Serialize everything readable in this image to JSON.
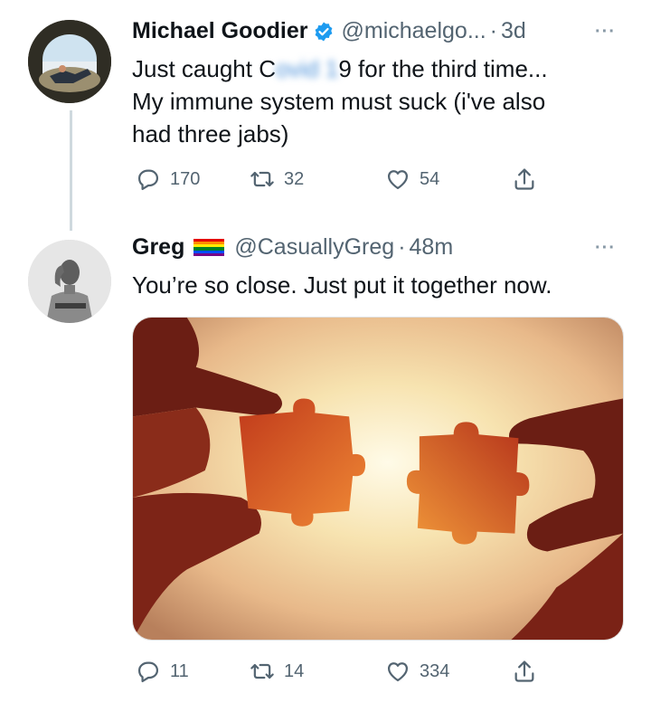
{
  "tweets": [
    {
      "display_name": "Michael Goodier",
      "verified": true,
      "handle": "@michaelgo...",
      "separator": "·",
      "time": "3d",
      "more": "···",
      "text_lines": [
        "Just caught Covid 19 for the third time...",
        "My immune system must suck (i've also",
        "had three jabs)"
      ],
      "text_before_blur": "Just caught C",
      "blurred_text": "ovid 1",
      "text_after_blur": "9 for the third time...",
      "actions": {
        "replies": "170",
        "retweets": "32",
        "likes": "54"
      }
    },
    {
      "display_name": "Greg",
      "badge": "rainbow-flag",
      "handle": "@CasuallyGreg",
      "separator": "·",
      "time": "48m",
      "more": "···",
      "text": "You’re so close. Just put it together now.",
      "media": {
        "description_icon": "puzzle-pieces-image"
      },
      "actions": {
        "replies": "11",
        "retweets": "14",
        "likes": "334"
      }
    }
  ],
  "colors": {
    "text_primary": "#0f1419",
    "text_secondary": "#536471",
    "verified_blue": "#1d9bf0",
    "thread_line": "#cfd9de"
  }
}
